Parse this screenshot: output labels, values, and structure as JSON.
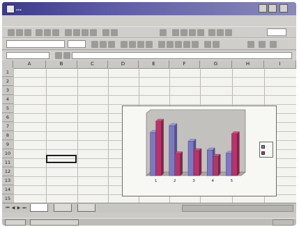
{
  "window": {
    "title": "…"
  },
  "menubar": {
    "items": [
      "",
      "",
      "",
      "",
      "",
      "",
      "",
      "",
      ""
    ]
  },
  "toolbars": {
    "font_name": "",
    "font_size": "",
    "zoom": ""
  },
  "formula_bar": {
    "name_box": "",
    "content": ""
  },
  "sheet": {
    "columns": [
      "A",
      "B",
      "C",
      "D",
      "E",
      "F",
      "G",
      "H",
      "I"
    ],
    "rows": [
      "1",
      "2",
      "3",
      "4",
      "5",
      "6",
      "7",
      "8",
      "9",
      "10",
      "11",
      "12",
      "13",
      "14",
      "15"
    ],
    "cells": {
      "a1": "",
      "b2": "",
      "c2": "",
      "a3": "",
      "b3": "",
      "c3": "",
      "a4": "",
      "b4": "",
      "c4": "",
      "a5": "",
      "b5": "",
      "c5": "",
      "a6": "",
      "b6": "",
      "c6": "",
      "a7": "",
      "b7": "",
      "c7": ""
    }
  },
  "chart_data": {
    "type": "bar",
    "title": "",
    "categories": [
      "1",
      "2",
      "3",
      "4",
      "5"
    ],
    "series": [
      {
        "name": "",
        "color": "#7c78c8",
        "values": [
          0.69,
          0.8,
          0.55,
          0.41,
          0.36
        ]
      },
      {
        "name": "",
        "color": "#b8336a",
        "values": [
          0.87,
          0.35,
          0.4,
          0.31,
          0.67
        ]
      }
    ],
    "y_ticks": [],
    "ylim": [
      0,
      1
    ],
    "grid": true,
    "legend_position": "right",
    "three_d": true
  },
  "sheet_tabs": {
    "tabs": [
      "",
      "",
      ""
    ],
    "active": 0
  },
  "status": {
    "text": ""
  },
  "taskbar": {
    "buttons": [
      "",
      ""
    ],
    "clock": ""
  }
}
